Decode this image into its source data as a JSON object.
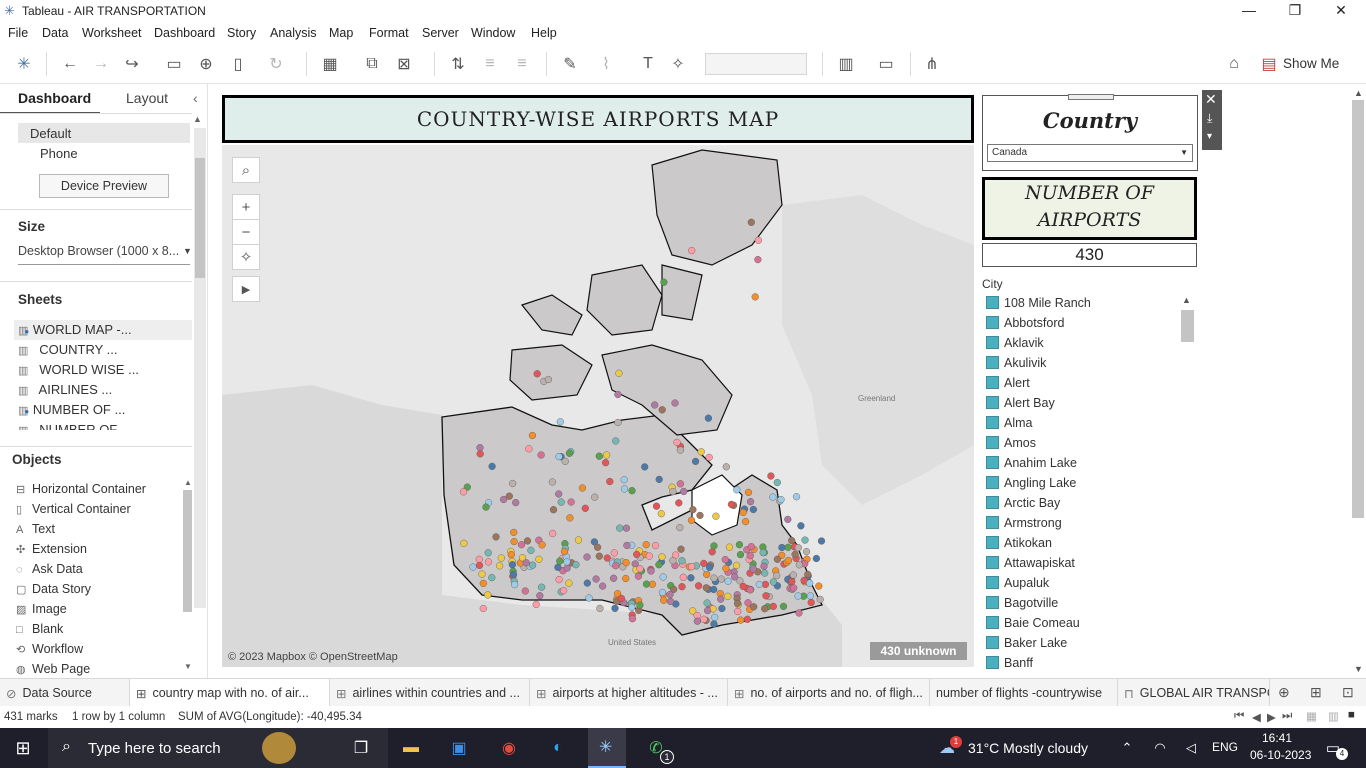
{
  "app": {
    "title": "Tableau - AIR TRANSPORTATION"
  },
  "menu": [
    "File",
    "Data",
    "Worksheet",
    "Dashboard",
    "Story",
    "Analysis",
    "Map",
    "Format",
    "Server",
    "Window",
    "Help"
  ],
  "toolbar": {
    "show_me": "Show Me"
  },
  "left_panel": {
    "tabs": [
      "Dashboard",
      "Layout"
    ],
    "device": {
      "default": "Default",
      "phone": "Phone",
      "preview_button": "Device Preview"
    },
    "size_title": "Size",
    "size_value": "Desktop Browser (1000 x 8...",
    "sheets_title": "Sheets",
    "sheets": [
      "WORLD MAP -...",
      "COUNTRY ...",
      "WORLD WISE ...",
      "AIRLINES ...",
      "NUMBER OF ...",
      "NUMBER OF ..."
    ],
    "objects_title": "Objects",
    "objects": [
      "Horizontal Container",
      "Vertical Container",
      "Text",
      "Extension",
      "Ask Data",
      "Data Story",
      "Image",
      "Blank",
      "Workflow",
      "Web Page"
    ]
  },
  "dashboard": {
    "title": "COUNTRY-WISE AIRPORTS MAP",
    "map_attribution": "© 2023 Mapbox © OpenStreetMap",
    "unknown_badge": "430 unknown",
    "map_labels": {
      "greenland": "Greenland",
      "united_states": "United States"
    }
  },
  "right_panel": {
    "country_title": "Country",
    "country_value": "Canada",
    "airports_title": "NUMBER OF AIRPORTS",
    "airports_count": "430",
    "city_header": "City",
    "cities": [
      "108 Mile Ranch",
      "Abbotsford",
      "Aklavik",
      "Akulivik",
      "Alert",
      "Alert Bay",
      "Alma",
      "Amos",
      "Anahim Lake",
      "Angling Lake",
      "Arctic Bay",
      "Armstrong",
      "Atikokan",
      "Attawapiskat",
      "Aupaluk",
      "Bagotville",
      "Baie Comeau",
      "Baker Lake",
      "Banff"
    ]
  },
  "tabs": [
    {
      "icon": "dashboard-icon",
      "label": "Data Source"
    },
    {
      "icon": "dashboard-icon",
      "label": "country map with no. of air..."
    },
    {
      "icon": "worksheet-icon",
      "label": "airlines within countries and ..."
    },
    {
      "icon": "worksheet-icon",
      "label": "airports at higher altitudes - ..."
    },
    {
      "icon": "worksheet-icon",
      "label": "no. of airports and no. of fligh..."
    },
    {
      "icon": "worksheet-icon",
      "label": "number of flights -countrywise"
    },
    {
      "icon": "story-icon",
      "label": "GLOBAL AIR TRANSPO"
    }
  ],
  "status": {
    "marks": "431 marks",
    "rows": "1 row by 1 column",
    "sum": "SUM of AVG(Longitude): -40,495.34"
  },
  "taskbar": {
    "search_placeholder": "Type here to search",
    "weather": "31°C  Mostly cloudy",
    "lang": "ENG",
    "time": "16:41",
    "date": "06-10-2023",
    "notifications": "4",
    "weather_badge": "1",
    "whatsapp_badge": "1"
  },
  "colors": {
    "accent": "#4ab0c0",
    "title_bg": "#dfeeea",
    "airports_bg": "#eef3e6"
  }
}
